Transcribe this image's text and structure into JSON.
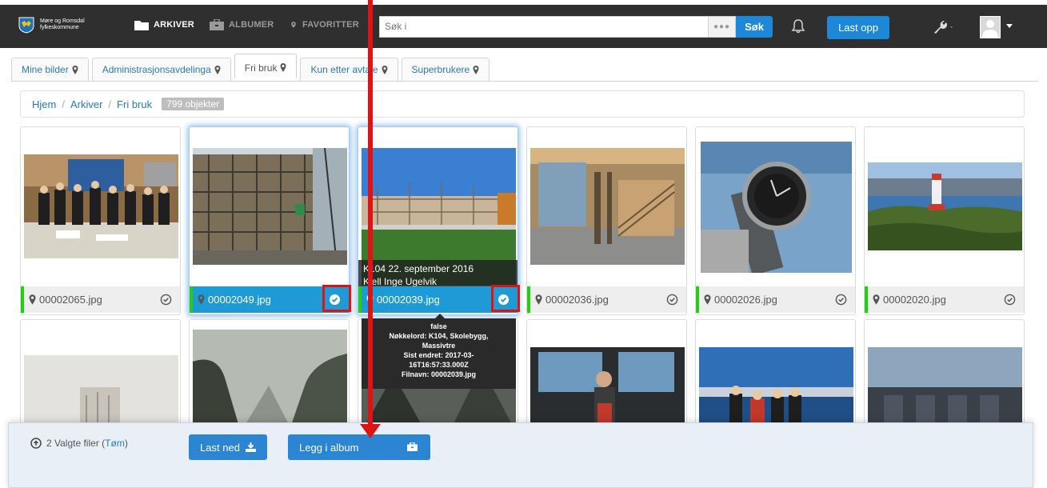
{
  "brand": {
    "name": "Møre og Romsdal fylkeskommune"
  },
  "nav": {
    "archives": "ARKIVER",
    "albums": "ALBUMER",
    "favorites": "FAVORITTER"
  },
  "search": {
    "placeholder": "Søk i",
    "dots": "●●●",
    "button": "Søk"
  },
  "header": {
    "upload": "Last opp"
  },
  "tabs": [
    {
      "label": "Mine bilder",
      "active": false
    },
    {
      "label": "Administrasjonsavdelinga",
      "active": false
    },
    {
      "label": "Fri bruk",
      "active": true
    },
    {
      "label": "Kun etter avtale",
      "active": false
    },
    {
      "label": "Superbrukere",
      "active": false
    }
  ],
  "breadcrumb": {
    "home": "Hjem",
    "archives": "Arkiver",
    "current": "Fri bruk",
    "count": "799 objekter",
    "separator": "/"
  },
  "files": [
    {
      "name": "00002065.jpg",
      "selected": false
    },
    {
      "name": "00002049.jpg",
      "selected": true
    },
    {
      "name": "00002039.jpg",
      "selected": true
    },
    {
      "name": "00002036.jpg",
      "selected": false
    },
    {
      "name": "00002026.jpg",
      "selected": false
    },
    {
      "name": "00002020.jpg",
      "selected": false
    }
  ],
  "hover_caption": {
    "line1": "K104 22. september 2016",
    "line2": "Kjell Inge Ugelvik"
  },
  "tooltip": {
    "line1": "false",
    "line2": "Nøkkelord: K104, Skolebygg,",
    "line3": "Massivtre",
    "line4": "Sist endret: 2017-03-",
    "line5": "16T16:57:33.000Z",
    "line6": "Filnavn: 00002039.jpg"
  },
  "actionbar": {
    "selected_text": "2 Valgte filer (",
    "clear": "Tøm",
    "close_paren": ")",
    "download": "Last ned",
    "add_album": "Legg i album"
  },
  "colors": {
    "topbar": "#2f2f2f",
    "accent": "#1e88d8",
    "link": "#2a7ab8",
    "selected": "#1e9bd6",
    "status": "#22d011",
    "annotation": "#e01313"
  },
  "icons": [
    "folder-icon",
    "briefcase-icon",
    "map-pin-icon",
    "bell-icon",
    "wrench-icon",
    "user-avatar-icon",
    "check-circle-icon",
    "upload-circle-icon",
    "download-icon"
  ]
}
